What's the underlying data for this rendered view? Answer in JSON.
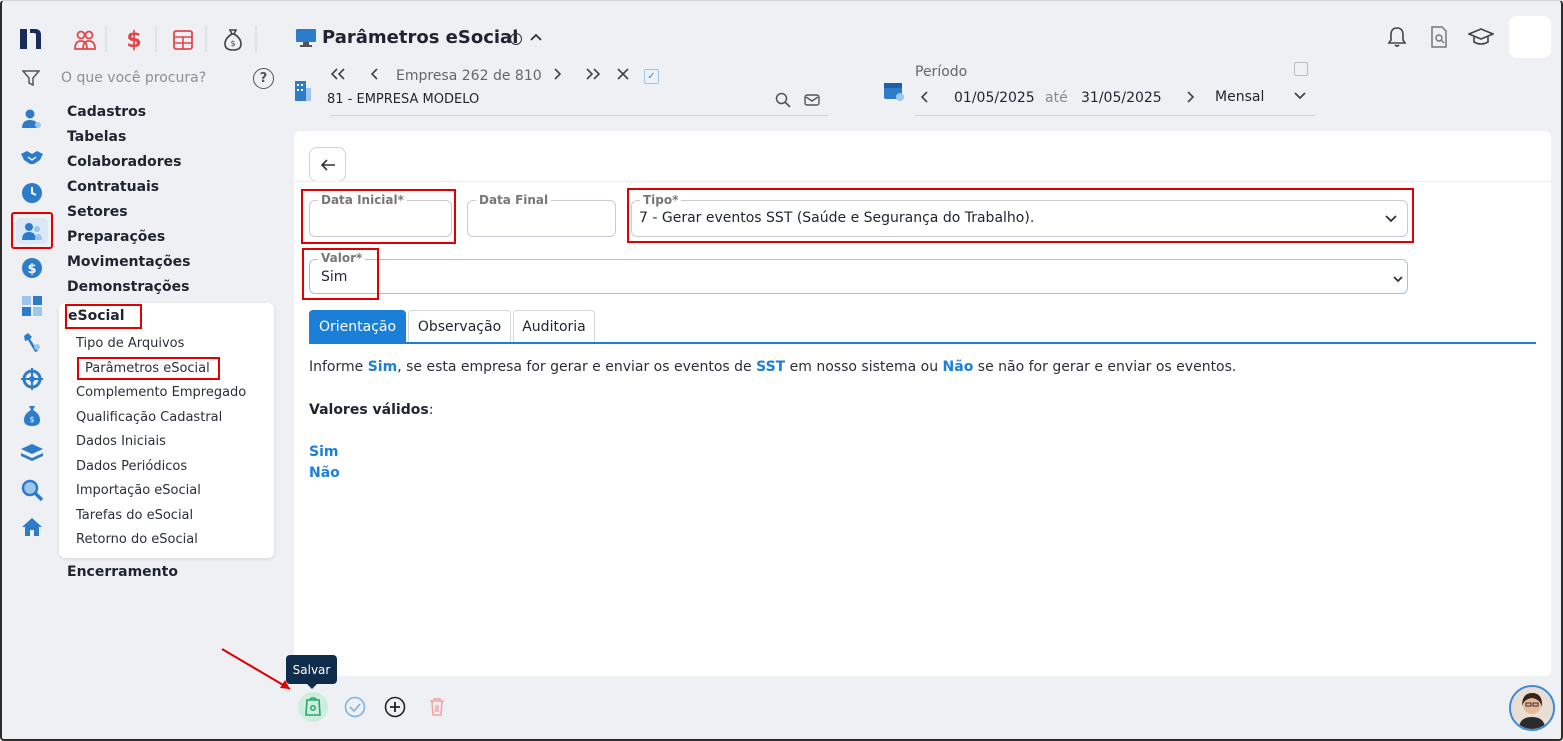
{
  "search": {
    "placeholder": "O que você procura?"
  },
  "nav": {
    "items": [
      "Cadastros",
      "Tabelas",
      "Colaboradores",
      "Contratuais",
      "Setores",
      "Preparações",
      "Movimentações",
      "Demonstrações"
    ],
    "esocial_title": "eSocial",
    "esocial_items": [
      "Tipo de Arquivos",
      "Parâmetros eSocial",
      "Complemento Empregado",
      "Qualificação Cadastral",
      "Dados Iniciais",
      "Dados Periódicos",
      "Importação eSocial",
      "Tarefas do eSocial",
      "Retorno do eSocial"
    ],
    "last_item": "Encerramento"
  },
  "header": {
    "title": "Parâmetros eSocial"
  },
  "empresa": {
    "label_prefix": "Empresa",
    "current": "262",
    "sep": "de",
    "total": "810",
    "name": "81 - EMPRESA MODELO"
  },
  "periodo": {
    "label": "Período",
    "start": "01/05/2025",
    "sep": "até",
    "end": "31/05/2025",
    "mode": "Mensal"
  },
  "form": {
    "data_inicial_label": "Data Inicial*",
    "data_inicial_value": "",
    "data_final_label": "Data Final",
    "data_final_value": "",
    "tipo_label": "Tipo*",
    "tipo_value": "7 - Gerar eventos SST (Saúde e Segurança do Trabalho).",
    "valor_label": "Valor*",
    "valor_value": "Sim"
  },
  "tabs": [
    "Orientação",
    "Observação",
    "Auditoria"
  ],
  "orientacao": {
    "t1": "Informe ",
    "sim": "Sim",
    "t2": ", se esta empresa for gerar e enviar os eventos de ",
    "sst": "SST",
    "t3": " em nosso sistema ou ",
    "nao": "Não",
    "t4": " se não for gerar e enviar os eventos.",
    "valid_title": "Valores válidos",
    "valid_colon": ":",
    "values": [
      "Sim",
      "Não"
    ]
  },
  "toolbar": {
    "tooltip": "Salvar"
  },
  "colors": {
    "accent": "#1b7fd8",
    "highlight_red": "#e00000",
    "brand_dark": "#1a2b5a"
  }
}
